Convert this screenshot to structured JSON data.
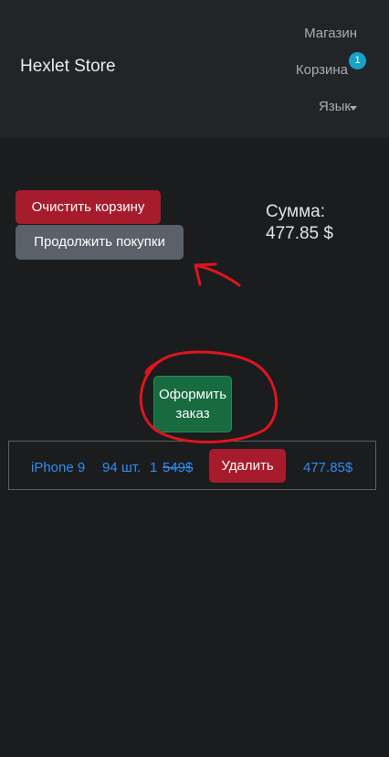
{
  "navbar": {
    "brand": "Hexlet Store",
    "shop_label": "Магазин",
    "cart_label": "Корзина",
    "cart_count": "1",
    "lang_label": "Язык"
  },
  "cart": {
    "clear_label": "Очистить корзину",
    "continue_label": "Продолжить покупки",
    "sum_label": "Сумма:",
    "sum_value": "477.85 $",
    "order_label_line1": "Оформить",
    "order_label_line2": "заказ",
    "items": [
      {
        "name": "iPhone 9",
        "stock": "94 шт.",
        "quantity": "1",
        "old_price": "549$",
        "delete_label": "Удалить",
        "total": "477.85$"
      }
    ]
  },
  "colors": {
    "background": "#1b1c1e",
    "navbar": "#222427",
    "danger": "#a61c2c",
    "secondary": "#5a6168",
    "success": "#176b3f",
    "link": "#2f8cf0",
    "badge": "#17a2c6",
    "annotation": "#e0141e"
  }
}
